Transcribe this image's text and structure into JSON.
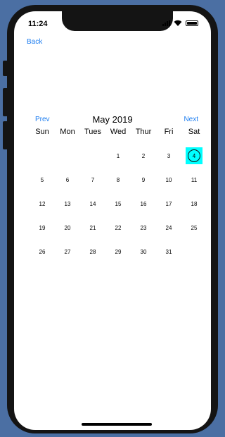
{
  "status_bar": {
    "time": "11:24"
  },
  "nav": {
    "back_label": "Back"
  },
  "calendar": {
    "prev_label": "Prev",
    "next_label": "Next",
    "month_title": "May 2019",
    "weekdays": [
      "Sun",
      "Mon",
      "Tues",
      "Wed",
      "Thur",
      "Fri",
      "Sat"
    ],
    "leading_blanks": 3,
    "days": [
      "1",
      "2",
      "3",
      "4",
      "5",
      "6",
      "7",
      "8",
      "9",
      "10",
      "11",
      "12",
      "13",
      "14",
      "15",
      "16",
      "17",
      "18",
      "19",
      "20",
      "21",
      "22",
      "23",
      "24",
      "25",
      "26",
      "27",
      "28",
      "29",
      "30",
      "31"
    ],
    "selected_day": "4",
    "selected_color": "#00ffff"
  },
  "colors": {
    "accent": "#1e7ef0",
    "background": "#4b6fa3",
    "device": "#141414"
  }
}
